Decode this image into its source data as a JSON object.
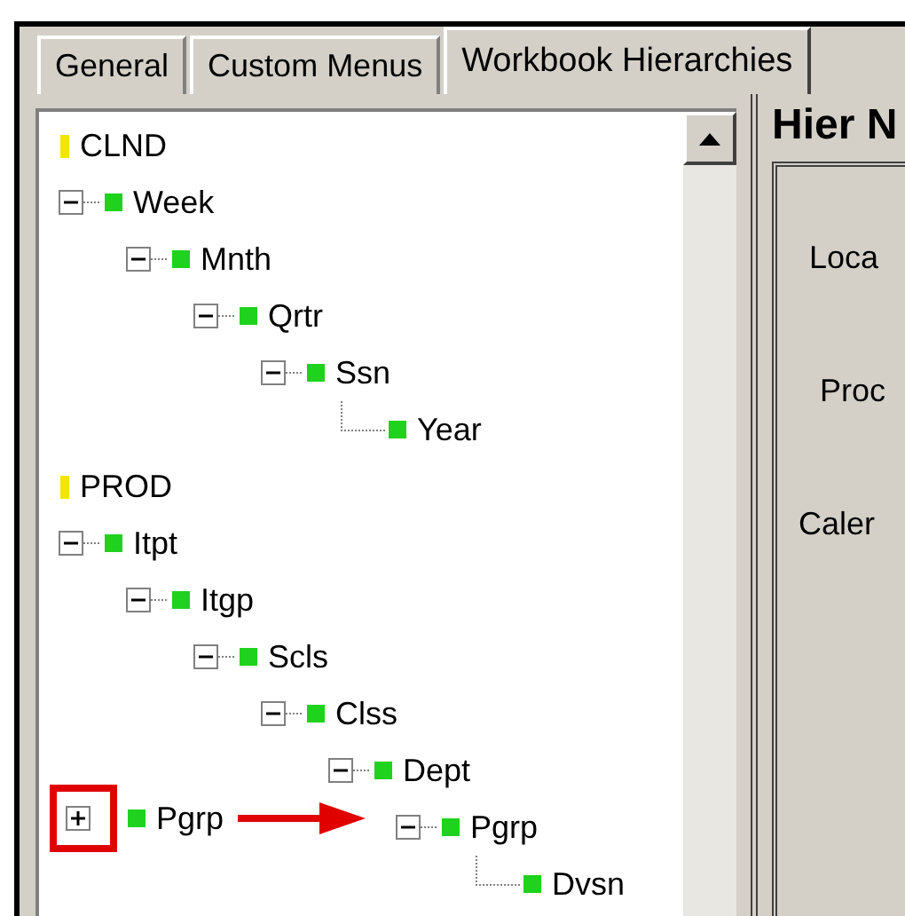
{
  "tabs": [
    {
      "label": "General",
      "selected": false
    },
    {
      "label": "Custom Menus",
      "selected": false
    },
    {
      "label": "Workbook Hierarchies",
      "selected": true
    }
  ],
  "tree": [
    {
      "label": "CLND",
      "color": "#f2e600",
      "children": [
        {
          "label": "Week",
          "color": "#1ed21e",
          "expanded": true,
          "children": [
            {
              "label": "Mnth",
              "color": "#1ed21e",
              "expanded": true,
              "children": [
                {
                  "label": "Qrtr",
                  "color": "#1ed21e",
                  "expanded": true,
                  "children": [
                    {
                      "label": "Ssn",
                      "color": "#1ed21e",
                      "expanded": true,
                      "children": [
                        {
                          "label": "Year",
                          "color": "#1ed21e"
                        }
                      ]
                    }
                  ]
                }
              ]
            }
          ]
        }
      ]
    },
    {
      "label": "PROD",
      "color": "#f2e600",
      "children": [
        {
          "label": "Itpt",
          "color": "#1ed21e",
          "expanded": true,
          "children": [
            {
              "label": "Itgp",
              "color": "#1ed21e",
              "expanded": true,
              "children": [
                {
                  "label": "Scls",
                  "color": "#1ed21e",
                  "expanded": true,
                  "children": [
                    {
                      "label": "Clss",
                      "color": "#1ed21e",
                      "expanded": true,
                      "children": [
                        {
                          "label": "Dept",
                          "color": "#1ed21e",
                          "expanded": true,
                          "children": [
                            {
                              "label": "Pgrp",
                              "color": "#1ed21e",
                              "expanded": true,
                              "children": [
                                {
                                  "label": "Dvsn",
                                  "color": "#1ed21e"
                                }
                              ]
                            }
                          ]
                        }
                      ]
                    }
                  ]
                }
              ]
            }
          ]
        }
      ]
    }
  ],
  "annotation": {
    "label": "Pgrp",
    "color": "#1ed21e",
    "expanded": false
  },
  "panel": {
    "title": "Hier N",
    "labels": [
      "Loca",
      "Proc",
      "Caler"
    ]
  }
}
